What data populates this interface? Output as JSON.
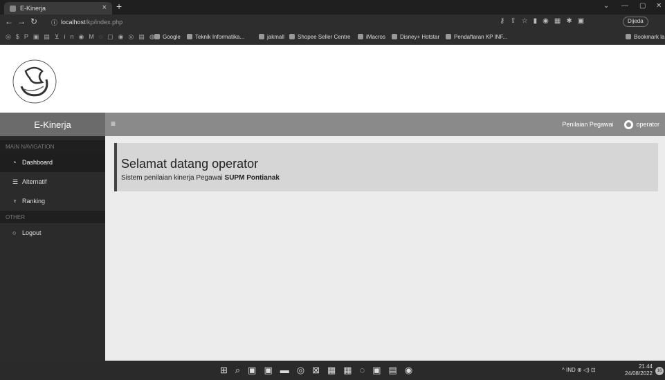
{
  "browser": {
    "tab_title": "E-Kinerja",
    "tab_close": "×",
    "new_tab": "+",
    "url_host": "localhost",
    "url_path": "/kp/index.php",
    "profile_label": "Dijeda",
    "bookmarks": [
      "Google",
      "Teknik Informatika...",
      "jakmall",
      "Shopee Seller Centre",
      "iMacros",
      "Disney+ Hotstar",
      "Pendaftaran KP INF...",
      "Bookmark la"
    ]
  },
  "app": {
    "brand": "E-Kinerja",
    "nav_link": "Penilaian Pegawai",
    "user_name": "operator"
  },
  "sidebar": {
    "main_header": "MAIN NAVIGATION",
    "items": [
      {
        "label": "Dashboard",
        "icon": "dashboard-icon"
      },
      {
        "label": "Alternatif",
        "icon": "list-icon"
      },
      {
        "label": "Ranking",
        "icon": "trophy-icon"
      }
    ],
    "other_header": "OTHER",
    "logout": "Logout"
  },
  "main": {
    "welcome_title": "Selamat datang operator",
    "welcome_text": "Sistem penilaian kinerja Pegawai ",
    "welcome_strong": "SUPM Pontianak"
  },
  "taskbar": {
    "lang": "IND",
    "time": "21.44",
    "date": "24/08/2022",
    "notifications": "16"
  }
}
